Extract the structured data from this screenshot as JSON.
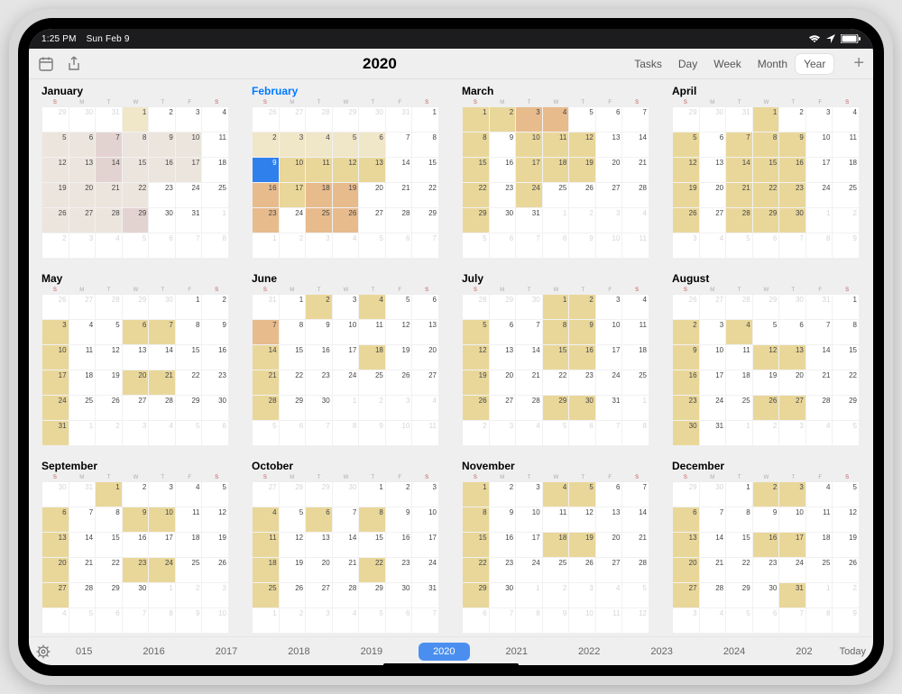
{
  "status": {
    "time": "1:25 PM",
    "date": "Sun Feb 9"
  },
  "toolbar": {
    "title": "2020",
    "views": [
      "Tasks",
      "Day",
      "Week",
      "Month",
      "Year"
    ],
    "active_view": 4
  },
  "dow": [
    "S",
    "M",
    "T",
    "W",
    "T",
    "F",
    "S"
  ],
  "timeline": {
    "years": [
      "015",
      "2016",
      "2017",
      "2018",
      "2019",
      "2020",
      "2021",
      "2022",
      "2023",
      "2024",
      "202"
    ],
    "current_index": 5,
    "today_label": "Today"
  },
  "year": 2020,
  "today": {
    "month": 1,
    "day": 9
  },
  "months": [
    {
      "name": "January",
      "first_dow": 3,
      "days": 31,
      "prev_tail": [
        29,
        30,
        31
      ],
      "hl": {
        "1": "hl-l",
        "5": "jan",
        "6": "jan",
        "7": "jan-p",
        "8": "jan",
        "9": "jan",
        "10": "jan",
        "12": "jan",
        "13": "jan",
        "14": "jan-p",
        "15": "jan",
        "16": "jan",
        "17": "jan",
        "19": "jan",
        "20": "jan",
        "21": "jan",
        "22": "jan",
        "26": "jan",
        "27": "jan",
        "28": "jan",
        "29": "jan-p"
      }
    },
    {
      "name": "February",
      "first_dow": 6,
      "days": 29,
      "prev_tail": [
        26,
        27,
        28,
        29,
        30,
        31
      ],
      "hl": {
        "2": "hl-l",
        "3": "hl-l",
        "4": "hl-l",
        "5": "hl-l",
        "6": "hl-l",
        "9": "today",
        "10": "hl",
        "11": "hl",
        "12": "hl",
        "13": "hl",
        "16": "hl-o",
        "17": "hl",
        "18": "hl-o",
        "19": "hl-o",
        "23": "hl-o",
        "25": "hl-o",
        "26": "hl-o"
      }
    },
    {
      "name": "March",
      "first_dow": 0,
      "days": 31,
      "prev_tail": [],
      "hl": {
        "1": "hl",
        "2": "hl",
        "3": "hl-o",
        "4": "hl-o",
        "8": "hl",
        "10": "hl",
        "11": "hl",
        "12": "hl",
        "15": "hl",
        "17": "hl",
        "18": "hl",
        "19": "hl",
        "22": "hl",
        "24": "hl",
        "29": "hl"
      }
    },
    {
      "name": "April",
      "first_dow": 3,
      "days": 30,
      "prev_tail": [
        29,
        30,
        31
      ],
      "hl": {
        "1": "hl",
        "5": "hl",
        "7": "hl",
        "8": "hl",
        "9": "hl",
        "12": "hl",
        "14": "hl",
        "15": "hl",
        "16": "hl",
        "19": "hl",
        "21": "hl",
        "22": "hl",
        "23": "hl",
        "26": "hl",
        "28": "hl",
        "29": "hl",
        "30": "hl"
      }
    },
    {
      "name": "May",
      "first_dow": 5,
      "days": 31,
      "prev_tail": [
        26,
        27,
        28,
        29,
        30
      ],
      "hl": {
        "3": "hl",
        "6": "hl",
        "7": "hl",
        "10": "hl",
        "17": "hl",
        "20": "hl",
        "21": "hl",
        "24": "hl",
        "31": "hl"
      }
    },
    {
      "name": "June",
      "first_dow": 1,
      "days": 30,
      "prev_tail": [
        31
      ],
      "hl": {
        "2": "hl",
        "4": "hl",
        "7": "hl-o",
        "14": "hl",
        "18": "hl",
        "21": "hl",
        "28": "hl"
      }
    },
    {
      "name": "July",
      "first_dow": 3,
      "days": 31,
      "prev_tail": [
        28,
        29,
        30
      ],
      "hl": {
        "1": "hl",
        "2": "hl",
        "5": "hl",
        "8": "hl",
        "9": "hl",
        "12": "hl",
        "15": "hl",
        "16": "hl",
        "19": "hl",
        "26": "hl",
        "29": "hl",
        "30": "hl"
      }
    },
    {
      "name": "August",
      "first_dow": 6,
      "days": 31,
      "prev_tail": [
        26,
        27,
        28,
        29,
        30,
        31
      ],
      "hl": {
        "2": "hl",
        "4": "hl",
        "9": "hl",
        "12": "hl",
        "13": "hl",
        "16": "hl",
        "23": "hl",
        "26": "hl",
        "27": "hl",
        "30": "hl"
      }
    },
    {
      "name": "September",
      "first_dow": 2,
      "days": 30,
      "prev_tail": [
        30,
        31
      ],
      "hl": {
        "1": "hl",
        "6": "hl",
        "9": "hl",
        "10": "hl",
        "13": "hl",
        "20": "hl",
        "23": "hl",
        "24": "hl",
        "27": "hl"
      }
    },
    {
      "name": "October",
      "first_dow": 4,
      "days": 31,
      "prev_tail": [
        27,
        28,
        29,
        30
      ],
      "hl": {
        "4": "hl",
        "6": "hl",
        "8": "hl",
        "11": "hl",
        "18": "hl",
        "22": "hl",
        "25": "hl"
      }
    },
    {
      "name": "November",
      "first_dow": 0,
      "days": 30,
      "prev_tail": [],
      "hl": {
        "1": "hl",
        "4": "hl",
        "5": "hl",
        "8": "hl",
        "15": "hl",
        "18": "hl",
        "19": "hl",
        "22": "hl",
        "29": "hl"
      }
    },
    {
      "name": "December",
      "first_dow": 2,
      "days": 31,
      "prev_tail": [
        29,
        30
      ],
      "hl": {
        "2": "hl",
        "3": "hl",
        "6": "hl",
        "13": "hl",
        "16": "hl",
        "17": "hl",
        "20": "hl",
        "27": "hl",
        "31": "hl"
      }
    }
  ]
}
